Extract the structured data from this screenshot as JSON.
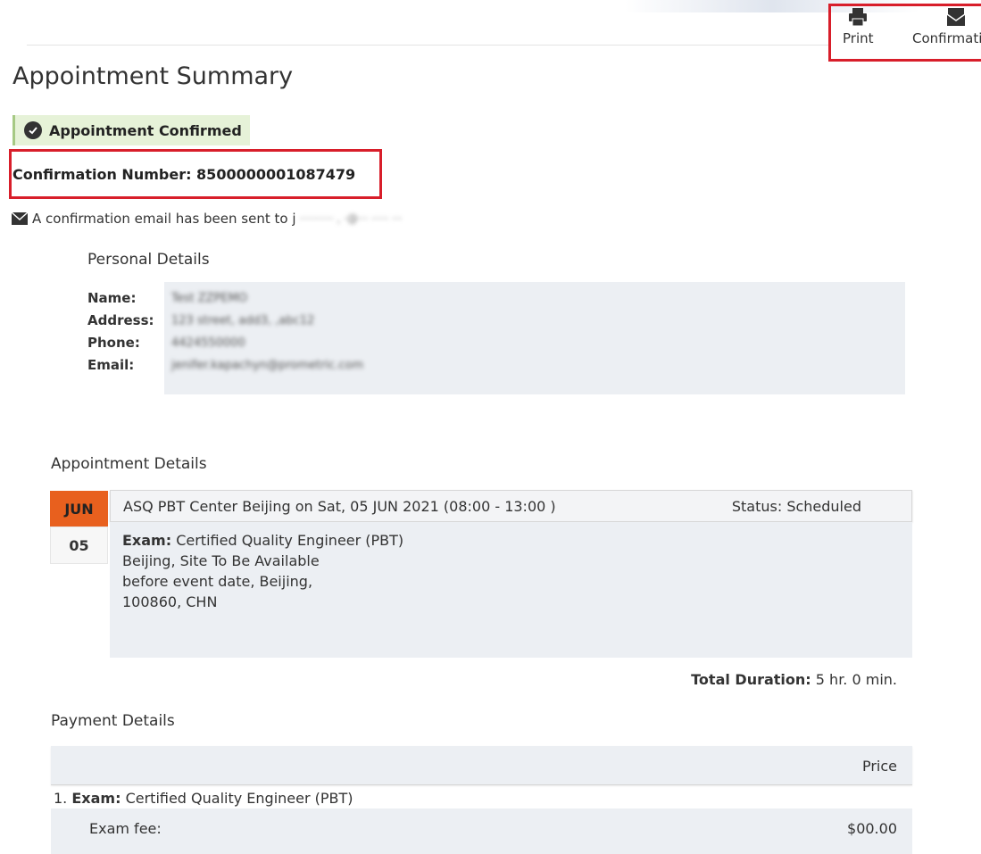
{
  "toolbar": {
    "print_label": "Print",
    "print_icon": "printer-icon",
    "confirmation_label": "Confirmation",
    "confirmation_icon": "envelope-icon"
  },
  "page": {
    "title": "Appointment Summary"
  },
  "status": {
    "label": "Appointment Confirmed",
    "icon": "check-circle-icon"
  },
  "confirmation": {
    "text": "Confirmation Number: 8500000001087479"
  },
  "email_notice": {
    "text": "A confirmation email has been sent to j",
    "redacted": "··········  ,  ·@··· ·····  ···",
    "icon": "envelope-icon"
  },
  "personal": {
    "heading": "Personal Details",
    "labels": {
      "name": "Name:",
      "address": "Address:",
      "phone": "Phone:",
      "email": "Email:"
    },
    "values": {
      "name": "Test ZZPEMO",
      "address": "123 street, add3, ,abc12",
      "phone": "4424550000",
      "email": "jenifer.kapachyn@prometric.com"
    }
  },
  "appointment": {
    "heading": "Appointment Details",
    "month": "JUN",
    "day": "05",
    "summary": "ASQ PBT Center Beijing on Sat, 05 JUN 2021 (08:00 - 13:00 )",
    "status": "Status: Scheduled",
    "exam_label": "Exam:",
    "exam_name": " Certified Quality Engineer (PBT)",
    "address_lines": [
      "Beijing, Site To Be Available",
      "before event date, Beijing,",
      "100860, CHN"
    ],
    "duration_label": "Total Duration:",
    "duration_value": " 5 hr. 0 min."
  },
  "payment": {
    "heading": "Payment Details",
    "price_header": "Price",
    "item_number": "1.",
    "exam_label": "Exam:",
    "exam_name": " Certified Quality Engineer (PBT)",
    "fee_label": "Exam fee:",
    "fee_amount": "$00.00"
  },
  "colors": {
    "highlight_border": "#d81e2a",
    "month_bg": "#e8601e",
    "badge_bg": "#e6f2d8",
    "panel_bg": "#eceff3"
  }
}
